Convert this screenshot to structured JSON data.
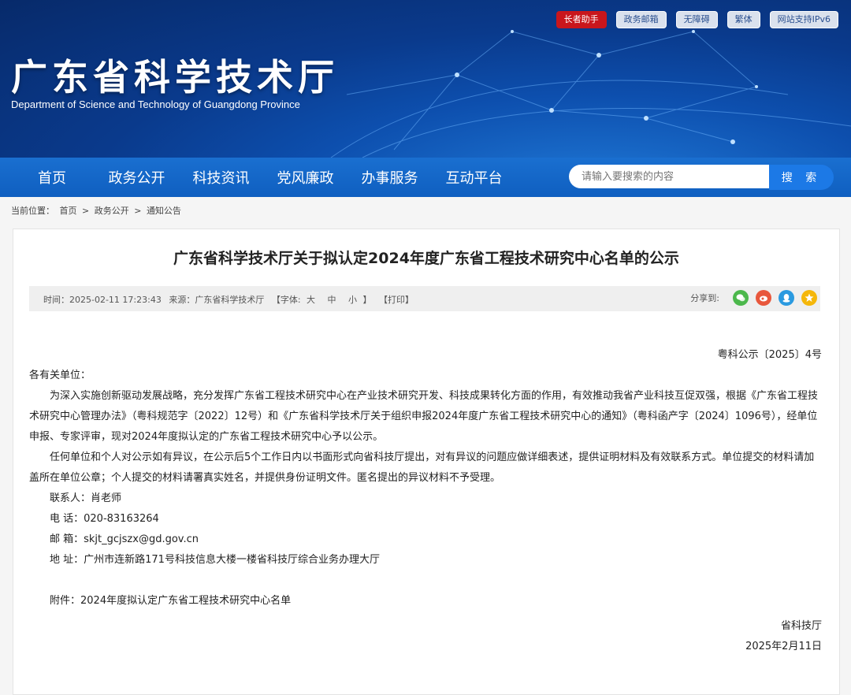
{
  "top_links": [
    "长者助手",
    "政务邮箱",
    "无障碍",
    "繁体",
    "网站支持IPv6"
  ],
  "site": {
    "title": "广东省科学技术厅",
    "subtitle": "Department of Science and Technology of Guangdong Province"
  },
  "nav": [
    "首页",
    "政务公开",
    "科技资讯",
    "党风廉政",
    "办事服务",
    "互动平台"
  ],
  "search": {
    "placeholder": "请输入要搜索的内容",
    "button": "搜 索"
  },
  "breadcrumb": {
    "label": "当前位置：",
    "items": [
      "首页",
      "政务公开",
      "通知公告"
    ],
    "sep": ">"
  },
  "article": {
    "title": "广东省科学技术厅关于拟认定2024年度广东省工程技术研究中心名单的公示",
    "time": "时间：2025-02-11 17:23:43",
    "source": "来源：广东省科学技术厅",
    "font_label": "【字体:",
    "font_sizes": [
      "大",
      "中",
      "小"
    ],
    "font_end": "】",
    "print": "【打印】",
    "share_label": "分享到:",
    "ref_no": "粤科公示〔2025〕4号",
    "salutation": "各有关单位：",
    "para1": "为深入实施创新驱动发展战略，充分发挥广东省工程技术研究中心在产业技术研究开发、科技成果转化方面的作用，有效推动我省产业科技互促双强，根据《广东省工程技术研究中心管理办法》（粤科规范字〔2022〕12号）和《广东省科学技术厅关于组织申报2024年度广东省工程技术研究中心的通知》（粤科函产字〔2024〕1096号），经单位申报、专家评审，现对2024年度拟认定的广东省工程技术研究中心予以公示。",
    "para2": "任何单位和个人对公示如有异议，在公示后5个工作日内以书面形式向省科技厅提出，对有异议的问题应做详细表述，提供证明材料及有效联系方式。单位提交的材料请加盖所在单位公章；个人提交的材料请署真实姓名，并提供身份证明文件。匿名提出的异议材料不予受理。",
    "contact": "联系人：肖老师",
    "phone": "电 话：020-83163264",
    "email": "邮 箱：skjt_gcjszx@gd.gov.cn",
    "address": "地 址：广州市连新路171号科技信息大楼一楼省科技厅综合业务办理大厅",
    "attachment": "附件：2024年度拟认定广东省工程技术研究中心名单",
    "signer": "省科技厅",
    "date": "2025年2月11日"
  },
  "colors": {
    "nav": "#1466c8",
    "banner": "#0a3a8c",
    "wechat": "#4cb84c",
    "weibo": "#e8573c",
    "qq": "#2a9ae0",
    "qzone": "#f5b70a"
  }
}
